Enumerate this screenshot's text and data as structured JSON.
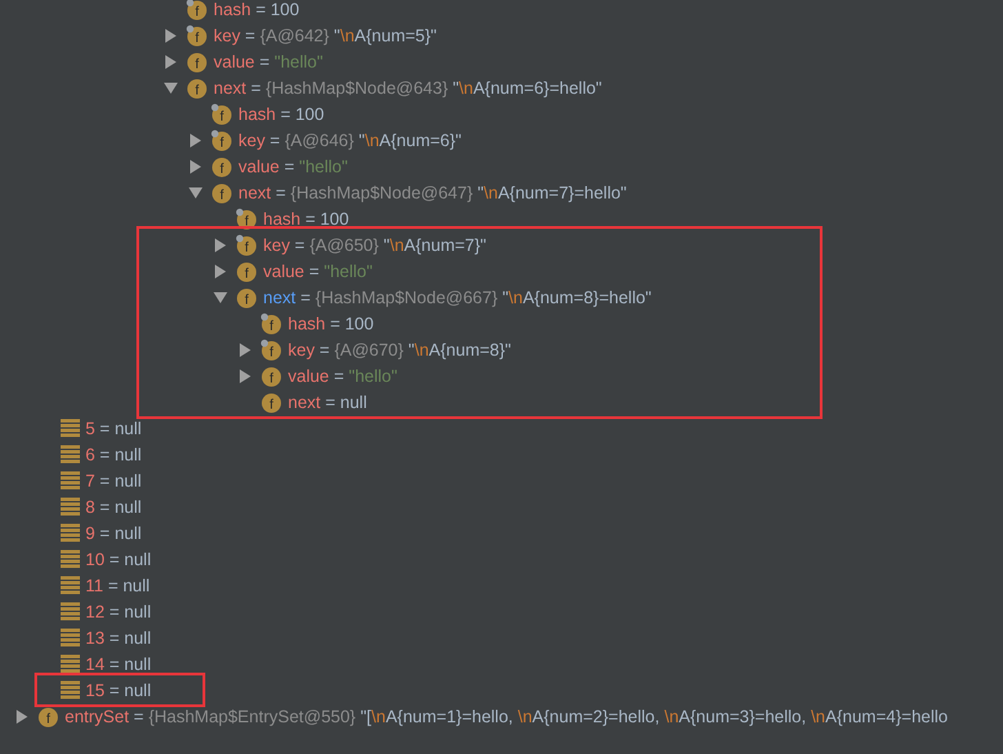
{
  "nodes": [
    {
      "kind": "final-field",
      "icon": "f",
      "parts": [
        {
          "kind": "name",
          "text": "hash"
        },
        {
          "kind": "plain",
          "text": " = 100"
        }
      ]
    },
    {
      "kind": "final-field",
      "icon": "f",
      "expanded": false,
      "parts": [
        {
          "kind": "name",
          "text": "key"
        },
        {
          "kind": "plain",
          "text": " = "
        },
        {
          "kind": "ref",
          "text": "{A@642} "
        },
        {
          "kind": "plain",
          "text": "\""
        },
        {
          "kind": "escape",
          "text": "\\n"
        },
        {
          "kind": "plain",
          "text": "A{num=5}\""
        }
      ]
    },
    {
      "kind": "field",
      "icon": "f",
      "expanded": false,
      "parts": [
        {
          "kind": "name",
          "text": "value"
        },
        {
          "kind": "plain",
          "text": " = "
        },
        {
          "kind": "string",
          "text": "\"hello\""
        }
      ]
    },
    {
      "kind": "field",
      "icon": "f",
      "expanded": true,
      "parts": [
        {
          "kind": "name",
          "text": "next"
        },
        {
          "kind": "plain",
          "text": " = "
        },
        {
          "kind": "ref",
          "text": "{HashMap$Node@643} "
        },
        {
          "kind": "plain",
          "text": "\""
        },
        {
          "kind": "escape",
          "text": "\\n"
        },
        {
          "kind": "plain",
          "text": "A{num=6}=hello\""
        }
      ],
      "children": [
        {
          "kind": "final-field",
          "icon": "f",
          "parts": [
            {
              "kind": "name",
              "text": "hash"
            },
            {
              "kind": "plain",
              "text": " = 100"
            }
          ]
        },
        {
          "kind": "final-field",
          "icon": "f",
          "expanded": false,
          "parts": [
            {
              "kind": "name",
              "text": "key"
            },
            {
              "kind": "plain",
              "text": " = "
            },
            {
              "kind": "ref",
              "text": "{A@646} "
            },
            {
              "kind": "plain",
              "text": "\""
            },
            {
              "kind": "escape",
              "text": "\\n"
            },
            {
              "kind": "plain",
              "text": "A{num=6}\""
            }
          ]
        },
        {
          "kind": "field",
          "icon": "f",
          "expanded": false,
          "parts": [
            {
              "kind": "name",
              "text": "value"
            },
            {
              "kind": "plain",
              "text": " = "
            },
            {
              "kind": "string",
              "text": "\"hello\""
            }
          ]
        },
        {
          "kind": "field",
          "icon": "f",
          "expanded": true,
          "parts": [
            {
              "kind": "name",
              "text": "next"
            },
            {
              "kind": "plain",
              "text": " = "
            },
            {
              "kind": "ref",
              "text": "{HashMap$Node@647} "
            },
            {
              "kind": "plain",
              "text": "\""
            },
            {
              "kind": "escape",
              "text": "\\n"
            },
            {
              "kind": "plain",
              "text": "A{num=7}=hello\""
            }
          ],
          "children": [
            {
              "kind": "final-field",
              "icon": "f",
              "parts": [
                {
                  "kind": "name",
                  "text": "hash"
                },
                {
                  "kind": "plain",
                  "text": " = 100"
                }
              ]
            },
            {
              "kind": "final-field",
              "icon": "f",
              "expanded": false,
              "parts": [
                {
                  "kind": "name",
                  "text": "key"
                },
                {
                  "kind": "plain",
                  "text": " = "
                },
                {
                  "kind": "ref",
                  "text": "{A@650} "
                },
                {
                  "kind": "plain",
                  "text": "\""
                },
                {
                  "kind": "escape",
                  "text": "\\n"
                },
                {
                  "kind": "plain",
                  "text": "A{num=7}\""
                }
              ]
            },
            {
              "kind": "field",
              "icon": "f",
              "expanded": false,
              "parts": [
                {
                  "kind": "name",
                  "text": "value"
                },
                {
                  "kind": "plain",
                  "text": " = "
                },
                {
                  "kind": "string",
                  "text": "\"hello\""
                }
              ]
            },
            {
              "kind": "field",
              "icon": "f",
              "expanded": true,
              "parts": [
                {
                  "kind": "name-active",
                  "text": "next"
                },
                {
                  "kind": "plain",
                  "text": " = "
                },
                {
                  "kind": "ref",
                  "text": "{HashMap$Node@667} "
                },
                {
                  "kind": "plain",
                  "text": "\""
                },
                {
                  "kind": "escape",
                  "text": "\\n"
                },
                {
                  "kind": "plain",
                  "text": "A{num=8}=hello\""
                }
              ],
              "children": [
                {
                  "kind": "final-field",
                  "icon": "f",
                  "parts": [
                    {
                      "kind": "name",
                      "text": "hash"
                    },
                    {
                      "kind": "plain",
                      "text": " = 100"
                    }
                  ]
                },
                {
                  "kind": "final-field",
                  "icon": "f",
                  "expanded": false,
                  "parts": [
                    {
                      "kind": "name",
                      "text": "key"
                    },
                    {
                      "kind": "plain",
                      "text": " = "
                    },
                    {
                      "kind": "ref",
                      "text": "{A@670} "
                    },
                    {
                      "kind": "plain",
                      "text": "\""
                    },
                    {
                      "kind": "escape",
                      "text": "\\n"
                    },
                    {
                      "kind": "plain",
                      "text": "A{num=8}\""
                    }
                  ]
                },
                {
                  "kind": "field",
                  "icon": "f",
                  "expanded": false,
                  "parts": [
                    {
                      "kind": "name",
                      "text": "value"
                    },
                    {
                      "kind": "plain",
                      "text": " = "
                    },
                    {
                      "kind": "string",
                      "text": "\"hello\""
                    }
                  ]
                },
                {
                  "kind": "field",
                  "icon": "f",
                  "parts": [
                    {
                      "kind": "name",
                      "text": "next"
                    },
                    {
                      "kind": "plain",
                      "text": " = null"
                    }
                  ]
                }
              ]
            }
          ]
        }
      ]
    }
  ],
  "elements": [
    {
      "kind": "element",
      "parts": [
        {
          "kind": "name",
          "text": "5"
        },
        {
          "kind": "plain",
          "text": " = null"
        }
      ]
    },
    {
      "kind": "element",
      "parts": [
        {
          "kind": "name",
          "text": "6"
        },
        {
          "kind": "plain",
          "text": " = null"
        }
      ]
    },
    {
      "kind": "element",
      "parts": [
        {
          "kind": "name",
          "text": "7"
        },
        {
          "kind": "plain",
          "text": " = null"
        }
      ]
    },
    {
      "kind": "element",
      "parts": [
        {
          "kind": "name",
          "text": "8"
        },
        {
          "kind": "plain",
          "text": " = null"
        }
      ]
    },
    {
      "kind": "element",
      "parts": [
        {
          "kind": "name",
          "text": "9"
        },
        {
          "kind": "plain",
          "text": " = null"
        }
      ]
    },
    {
      "kind": "element",
      "parts": [
        {
          "kind": "name",
          "text": "10"
        },
        {
          "kind": "plain",
          "text": " = null"
        }
      ]
    },
    {
      "kind": "element",
      "parts": [
        {
          "kind": "name",
          "text": "11"
        },
        {
          "kind": "plain",
          "text": " = null"
        }
      ]
    },
    {
      "kind": "element",
      "parts": [
        {
          "kind": "name",
          "text": "12"
        },
        {
          "kind": "plain",
          "text": " = null"
        }
      ]
    },
    {
      "kind": "element",
      "parts": [
        {
          "kind": "name",
          "text": "13"
        },
        {
          "kind": "plain",
          "text": " = null"
        }
      ]
    },
    {
      "kind": "element",
      "parts": [
        {
          "kind": "name",
          "text": "14"
        },
        {
          "kind": "plain",
          "text": " = null"
        }
      ]
    },
    {
      "kind": "element",
      "parts": [
        {
          "kind": "name",
          "text": "15"
        },
        {
          "kind": "plain",
          "text": " = null"
        }
      ]
    }
  ],
  "entry_set": {
    "kind": "field",
    "icon": "f",
    "expanded": false,
    "parts": [
      {
        "kind": "name",
        "text": "entrySet"
      },
      {
        "kind": "plain",
        "text": " = "
      },
      {
        "kind": "ref",
        "text": "{HashMap$EntrySet@550} "
      },
      {
        "kind": "plain",
        "text": "\"["
      },
      {
        "kind": "escape",
        "text": "\\n"
      },
      {
        "kind": "plain",
        "text": "A{num=1}=hello, "
      },
      {
        "kind": "escape",
        "text": "\\n"
      },
      {
        "kind": "plain",
        "text": "A{num=2}=hello, "
      },
      {
        "kind": "escape",
        "text": "\\n"
      },
      {
        "kind": "plain",
        "text": "A{num=3}=hello, "
      },
      {
        "kind": "escape",
        "text": "\\n"
      },
      {
        "kind": "plain",
        "text": "A{num=4}=hello"
      }
    ]
  }
}
